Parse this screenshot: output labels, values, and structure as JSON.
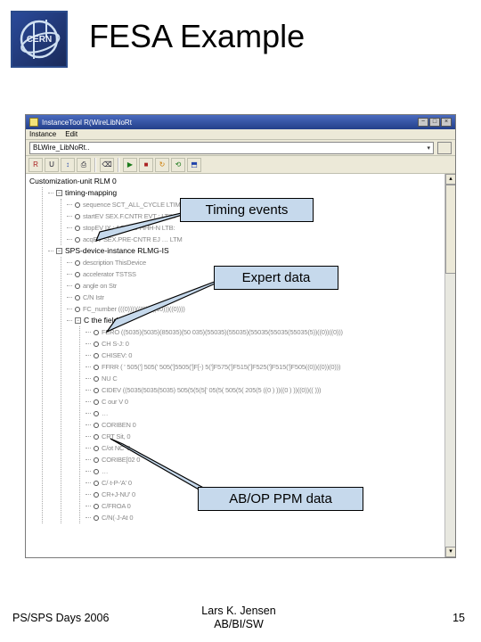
{
  "title": "FESA Example",
  "logo_text": "CERN",
  "window": {
    "title": "InstanceTool   R(WireLibNoRt",
    "menu": [
      "Instance",
      "Edit"
    ],
    "combo_value": "BLWire_LibNoRt..",
    "toolbar_icons": [
      "R",
      "U",
      "↕",
      "⎙",
      "⌫",
      "▶",
      "■",
      "↻",
      "⟲",
      "⬒"
    ]
  },
  "tree": {
    "root": "Customization-unit  RLM  0",
    "grp_timing": "timing-mapping",
    "timing": [
      "sequence SCT_ALL_CYCLE  LTIM  #",
      "startEV SEX.F.CNTR   EVT :  LTIM",
      "stopEV IX : AQ-JAJ-HHH-N  LTB:",
      "acqEV SEX.PRE-CNTR  EJ  …  LTM"
    ],
    "grp_instance": "SPS-device-instance   RLMG-IS",
    "instance_items": [
      "description  ThisDevice",
      "accelerator TSTSS",
      "angle on  Str",
      "C/N  Istr",
      "FC_number (((0))))((0))))((10)))((0))))"
    ],
    "grp_fields": "C the fields",
    "fields": [
      "FERO ((5035)(5035)(85035)(50 035)(55035)(55035)(55035(55035(55035(5))((0))((0)))",
      "CH S-J:  0",
      "CHISEV: 0",
      "FFRR  ( ' 505('] 505(' 505(']5505(']F[-) 5(']F575(']F515(']F525(']F515(']F505((0))((0))(0)))",
      "NU  C",
      "CIDEV ((5035(5035(5035) 505(5(5(5[' 05(5( 505(5( 205(5 ((0 ) ))((0 ) ))((0))(( )))",
      "C our V  0",
      "…",
      "CORIBEN 0",
      "CRT Sit,  0",
      "C/ot NC' 0",
      "CORIBE[02  0",
      "…",
      "C/·t-P-'A'  0",
      "CR+J-NU' 0",
      "C/FROA  0",
      "C/N(·J-At  0"
    ]
  },
  "callouts": {
    "timing": "Timing events",
    "expert": "Expert data",
    "ppm": "AB/OP PPM data"
  },
  "footer": {
    "left": "PS/SPS Days 2006",
    "center_line1": "Lars K. Jensen",
    "center_line2": "AB/BI/SW",
    "page": "15"
  }
}
